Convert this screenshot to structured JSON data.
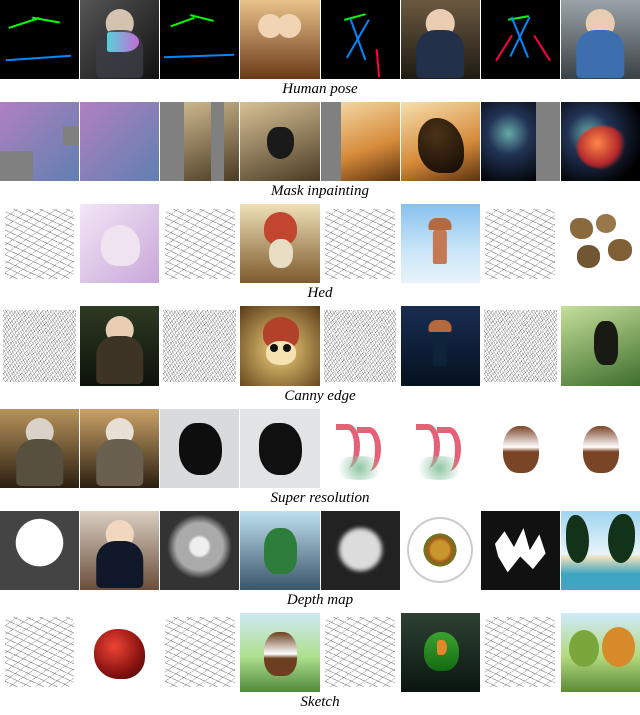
{
  "figure": {
    "rows": [
      {
        "label": "Human pose",
        "pairs": [
          {
            "condition": "pose-skeleton",
            "output": "woman-with-colorful-mask"
          },
          {
            "condition": "pose-skeleton",
            "output": "two-smiling-children"
          },
          {
            "condition": "pose-skeleton",
            "output": "man-arms-crossed-bookshelf"
          },
          {
            "condition": "pose-skeleton",
            "output": "man-hands-on-hips-workshop"
          }
        ]
      },
      {
        "label": "Mask inpainting",
        "pairs": [
          {
            "condition": "ram-painting-with-gray-mask-regions",
            "output": "ram-painting-filled"
          },
          {
            "condition": "french-bulldog-scene-masked",
            "output": "french-bulldog-scene"
          },
          {
            "condition": "gnarled-tree-sunset-masked",
            "output": "gnarled-tree-sunset"
          },
          {
            "condition": "nebula-galaxy-masked",
            "output": "nebula-galaxy"
          }
        ]
      },
      {
        "label": "Hed",
        "pairs": [
          {
            "condition": "hed-edges-unicorn",
            "output": "unicorn-illustration"
          },
          {
            "condition": "hed-edges-rabbit-mushroom",
            "output": "rabbit-under-mushroom"
          },
          {
            "condition": "hed-edges-tower",
            "output": "ornate-tower-blue-sky"
          },
          {
            "condition": "hed-edges-flowers",
            "output": "wooden-flower-shapes"
          }
        ]
      },
      {
        "label": "Canny  edge",
        "pairs": [
          {
            "condition": "canny-edges-woman",
            "output": "woman-portrait-forest"
          },
          {
            "condition": "canny-edges-mushroom-character",
            "output": "cartoon-mushroom-character"
          },
          {
            "condition": "canny-edges-castle",
            "output": "fantasy-castle-dusk"
          },
          {
            "condition": "canny-edges-woodpecker",
            "output": "woodpecker-on-bark"
          }
        ]
      },
      {
        "label": "Super resolution",
        "pairs": [
          {
            "condition": "astronaut-low-res",
            "output": "astronaut-high-res"
          },
          {
            "condition": "black-horse-low-res",
            "output": "black-horse-high-res"
          },
          {
            "condition": "two-flamingos-watercolor-low-res",
            "output": "two-flamingos-watercolor-high-res"
          },
          {
            "condition": "beagle-dog-low-res",
            "output": "beagle-dog-high-res"
          }
        ]
      },
      {
        "label": "Depth map",
        "pairs": [
          {
            "condition": "depth-silhouette-person",
            "output": "woman-business-portrait"
          },
          {
            "condition": "depth-figure",
            "output": "ninja-turtle-illustration"
          },
          {
            "condition": "depth-round-plate",
            "output": "gourmet-dish-top-down"
          },
          {
            "condition": "depth-palm-trees",
            "output": "tropical-beach-palms"
          }
        ]
      },
      {
        "label": "Sketch",
        "pairs": [
          {
            "condition": "sketch-dragon",
            "output": "red-dragon-illustration"
          },
          {
            "condition": "sketch-dog",
            "output": "beagle-in-grass"
          },
          {
            "condition": "sketch-branch-bird",
            "output": "green-parrot-on-branch"
          },
          {
            "condition": "sketch-trees",
            "output": "autumn-trees-field"
          }
        ]
      }
    ]
  }
}
